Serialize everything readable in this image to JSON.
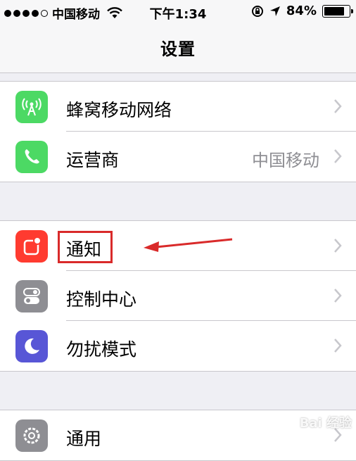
{
  "status_bar": {
    "carrier": "中国移动",
    "time": "下午1:34",
    "battery_percent": "84%",
    "battery_level": 0.84
  },
  "nav": {
    "title": "设置"
  },
  "groups": [
    {
      "items": [
        {
          "label": "蜂窝移动网络",
          "icon": "cellular-antenna-icon",
          "color": "#4cd964"
        },
        {
          "label": "运营商",
          "value": "中国移动",
          "icon": "phone-icon",
          "color": "#4cd964"
        }
      ]
    },
    {
      "items": [
        {
          "label": "通知",
          "icon": "notifications-icon",
          "color": "#ff3b30"
        },
        {
          "label": "控制中心",
          "icon": "toggles-icon",
          "color": "#8e8e93"
        },
        {
          "label": "勿扰模式",
          "icon": "moon-icon",
          "color": "#5856d6"
        }
      ]
    },
    {
      "items": [
        {
          "label": "通用",
          "icon": "gear-icon",
          "color": "#8e8e93"
        }
      ]
    }
  ],
  "annotation": {
    "highlight_color": "#d92a2a"
  },
  "watermark": "Bai 经验"
}
